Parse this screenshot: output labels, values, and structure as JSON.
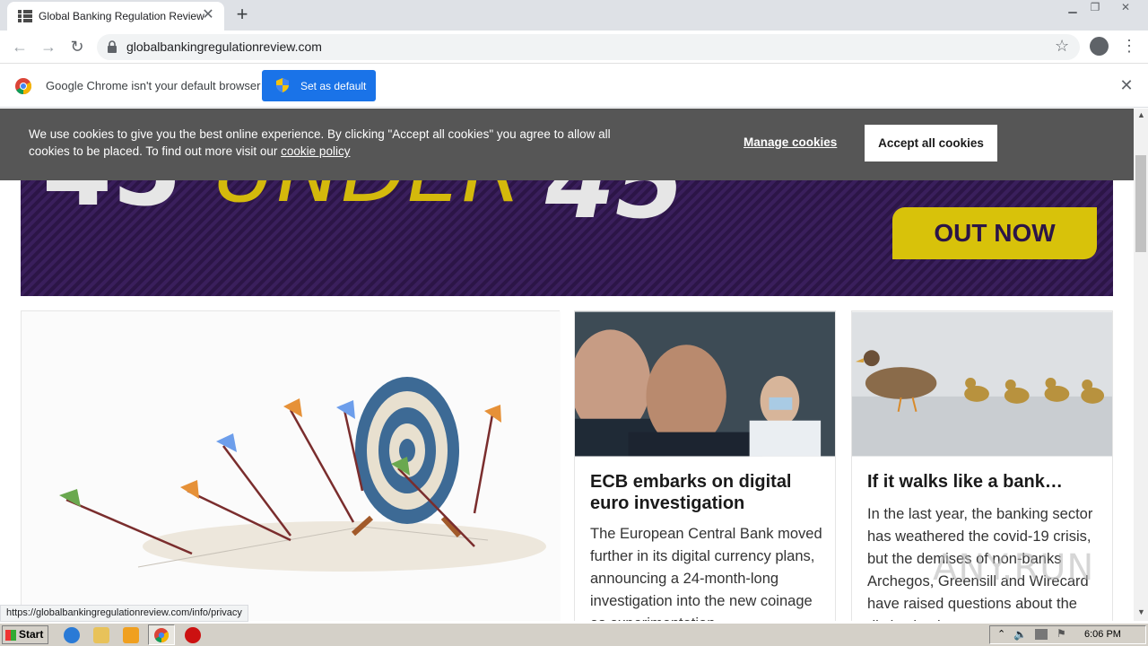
{
  "browser": {
    "tab_title": "Global Banking Regulation Review",
    "url": "globalbankingregulationreview.com",
    "status_url": "https://globalbankingregulationreview.com/info/privacy"
  },
  "infobar": {
    "message": "Google Chrome isn't your default browser",
    "button": "Set as default"
  },
  "cookie": {
    "text": "We use cookies to give you the best online experience. By clicking \"Accept all cookies\" you agree to allow all cookies to be placed. To find out more visit our ",
    "link": "cookie policy",
    "manage": "Manage cookies",
    "accept": "Accept all cookies"
  },
  "banner": {
    "num1": "45",
    "word": "UNDER",
    "num2": "45",
    "cta": "OUT NOW"
  },
  "articles": [
    {
      "title": "ECB embarks on digital euro investigation",
      "excerpt": "The European Central Bank moved further in its digital currency plans, announcing a 24-month-long investigation into the new coinage as experimentation"
    },
    {
      "title": "If it walks like a bank…",
      "excerpt": "In the last year, the banking sector has weathered the covid-19 crisis, but the demises of non-banks Archegos, Greensill and Wirecard have raised questions about the distinction between"
    }
  ],
  "watermark": "ANY.RUN",
  "taskbar": {
    "start": "Start",
    "clock": "6:06 PM"
  }
}
